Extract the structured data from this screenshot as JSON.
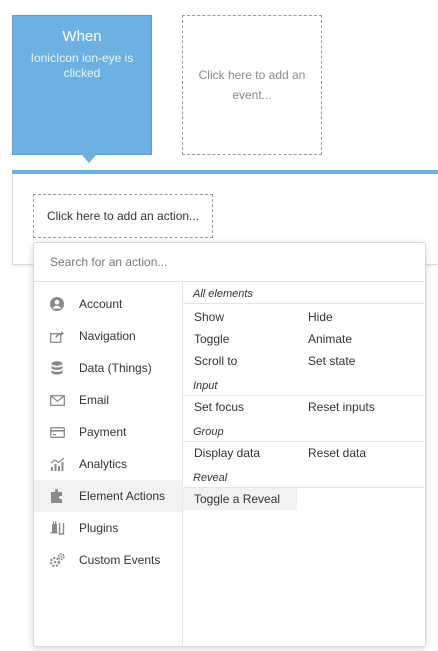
{
  "event": {
    "when": "When",
    "description": "IonicIcon ion-eye is clicked"
  },
  "add_event": {
    "label": "Click here to add an event..."
  },
  "add_action": {
    "label": "Click here to add an action..."
  },
  "search": {
    "placeholder": "Search for an action..."
  },
  "categories": [
    {
      "label": "Account",
      "icon": "account-icon"
    },
    {
      "label": "Navigation",
      "icon": "navigation-icon"
    },
    {
      "label": "Data (Things)",
      "icon": "database-icon"
    },
    {
      "label": "Email",
      "icon": "email-icon"
    },
    {
      "label": "Payment",
      "icon": "payment-icon"
    },
    {
      "label": "Analytics",
      "icon": "analytics-icon"
    },
    {
      "label": "Element Actions",
      "icon": "element-actions-icon",
      "active": true
    },
    {
      "label": "Plugins",
      "icon": "plugins-icon"
    },
    {
      "label": "Custom Events",
      "icon": "custom-events-icon"
    }
  ],
  "groups": {
    "all_elements": {
      "title": "All elements",
      "actions": [
        "Show",
        "Hide",
        "Toggle",
        "Animate",
        "Scroll to",
        "Set state"
      ]
    },
    "input": {
      "title": "Input",
      "actions": [
        "Set focus",
        "Reset inputs"
      ]
    },
    "group": {
      "title": "Group",
      "actions": [
        "Display data",
        "Reset data"
      ]
    },
    "reveal": {
      "title": "Reveal",
      "actions": [
        "Toggle a Reveal"
      ]
    }
  },
  "colors": {
    "accent": "#6db1e2",
    "icon": "#8a8a8a"
  }
}
